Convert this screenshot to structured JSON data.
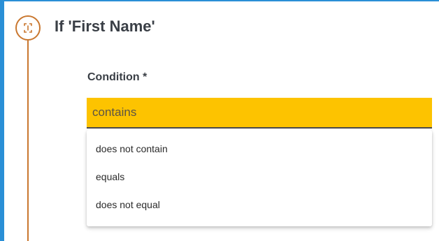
{
  "colors": {
    "accent_border": "#2a8fd6",
    "timeline": "#c9772f",
    "select_background": "#fdc300"
  },
  "step": {
    "icon": "dashed-bracket-circle-icon",
    "title": "If 'First Name'"
  },
  "condition": {
    "label": "Condition *",
    "selected_value": "contains",
    "options": [
      {
        "label": "does not contain"
      },
      {
        "label": "equals"
      },
      {
        "label": "does not equal"
      }
    ]
  }
}
